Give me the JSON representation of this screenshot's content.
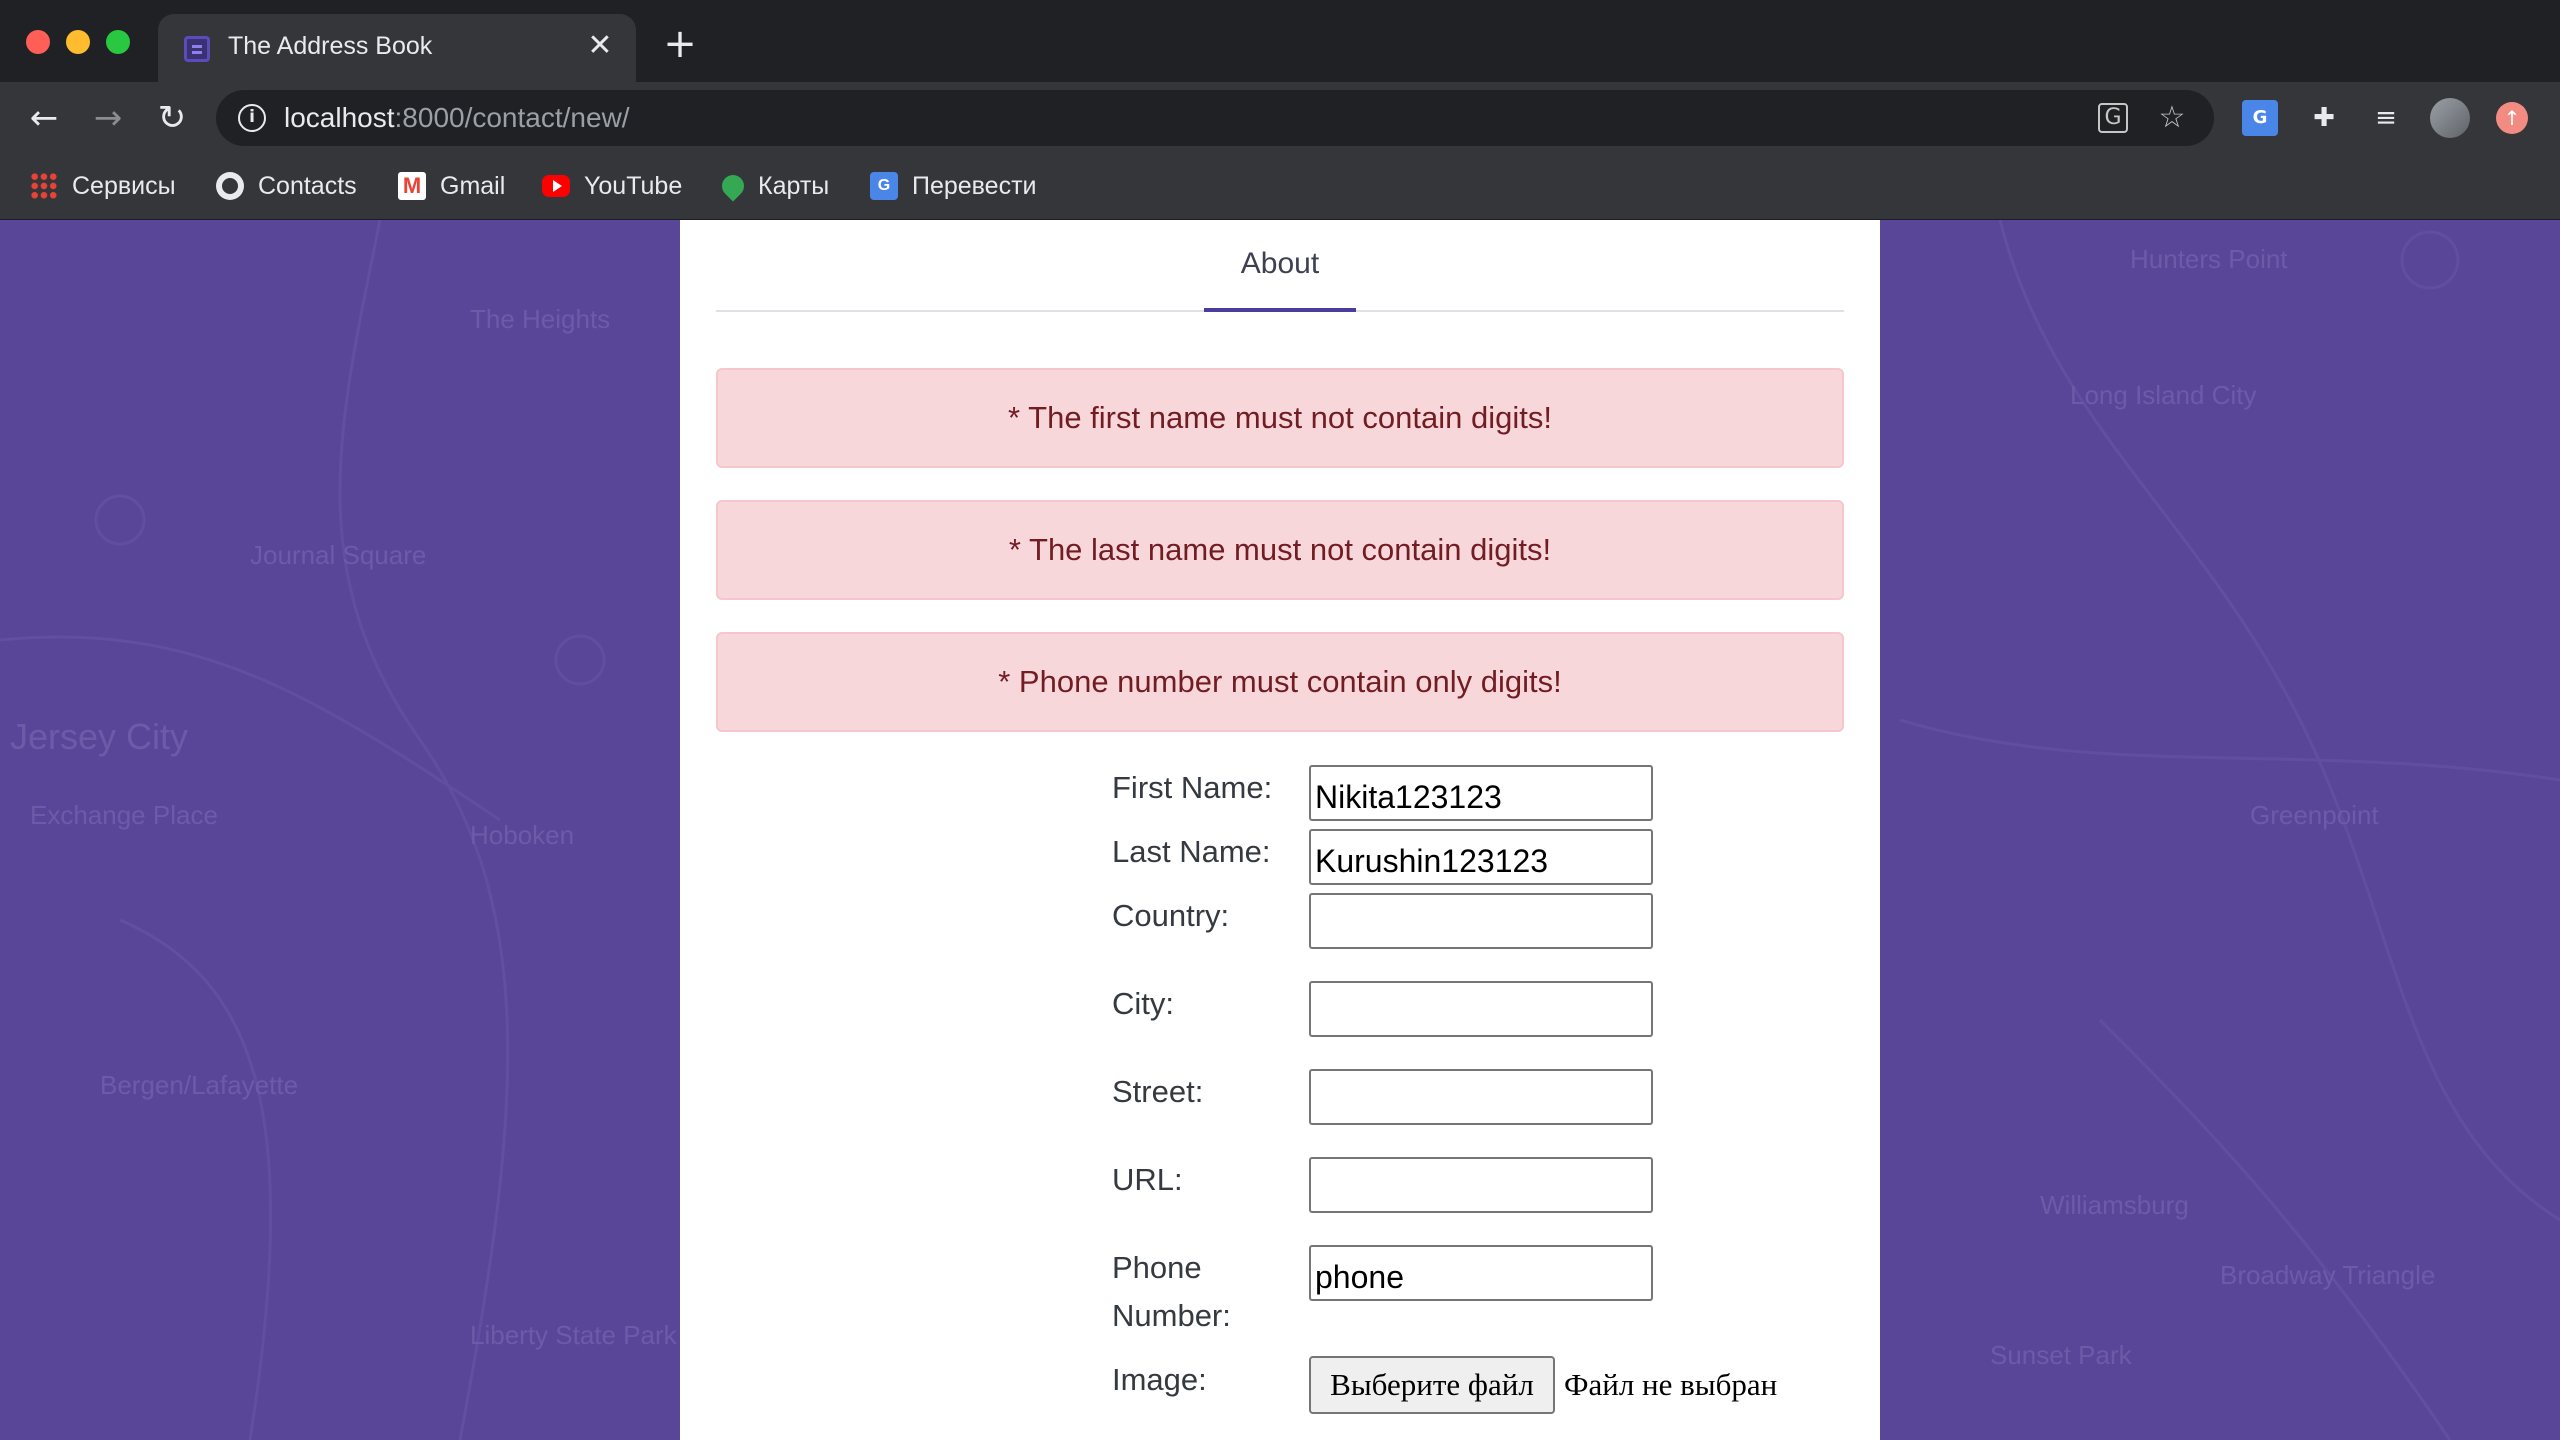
{
  "browser": {
    "tab_title": "The Address Book",
    "tab_close": "✕",
    "new_tab": "+",
    "url_host": "localhost",
    "url_path": ":8000/contact/new/",
    "bookmarks": [
      {
        "label": "Сервисы"
      },
      {
        "label": "Contacts"
      },
      {
        "label": "Gmail"
      },
      {
        "label": "YouTube"
      },
      {
        "label": "Карты"
      },
      {
        "label": "Перевести"
      }
    ]
  },
  "page": {
    "nav_tab": "About",
    "errors": [
      "* The first name must not contain digits!",
      "* The last name must not contain digits!",
      "* Phone number must contain only digits!"
    ],
    "form": {
      "first_name_label": "First Name:",
      "first_name_value": "Nikita123123",
      "last_name_label": "Last Name:",
      "last_name_value": "Kurushin123123",
      "country_label": "Country:",
      "country_value": "",
      "city_label": "City:",
      "city_value": "",
      "street_label": "Street:",
      "street_value": "",
      "url_label": "URL:",
      "url_value": "",
      "phone_label_line1": "Phone",
      "phone_label_line2": "Number:",
      "phone_value": "phone",
      "image_label": "Image:",
      "file_button": "Выберите файл",
      "file_status": "Файл не выбран"
    },
    "map_labels": [
      "The Heights",
      "Journal Square",
      "Jersey City",
      "Hoboken",
      "Bergen/Lafayette",
      "Exchange Place",
      "Hunters Point",
      "Long Island City",
      "Greenpoint",
      "Williamsburg",
      "Broadway Triangle",
      "Sunset Park",
      "Liberty State Park"
    ]
  },
  "colors": {
    "background": "#5a4699",
    "alert_bg": "#f8d7da",
    "alert_text": "#721c24",
    "accent": "#4b3d9b"
  }
}
